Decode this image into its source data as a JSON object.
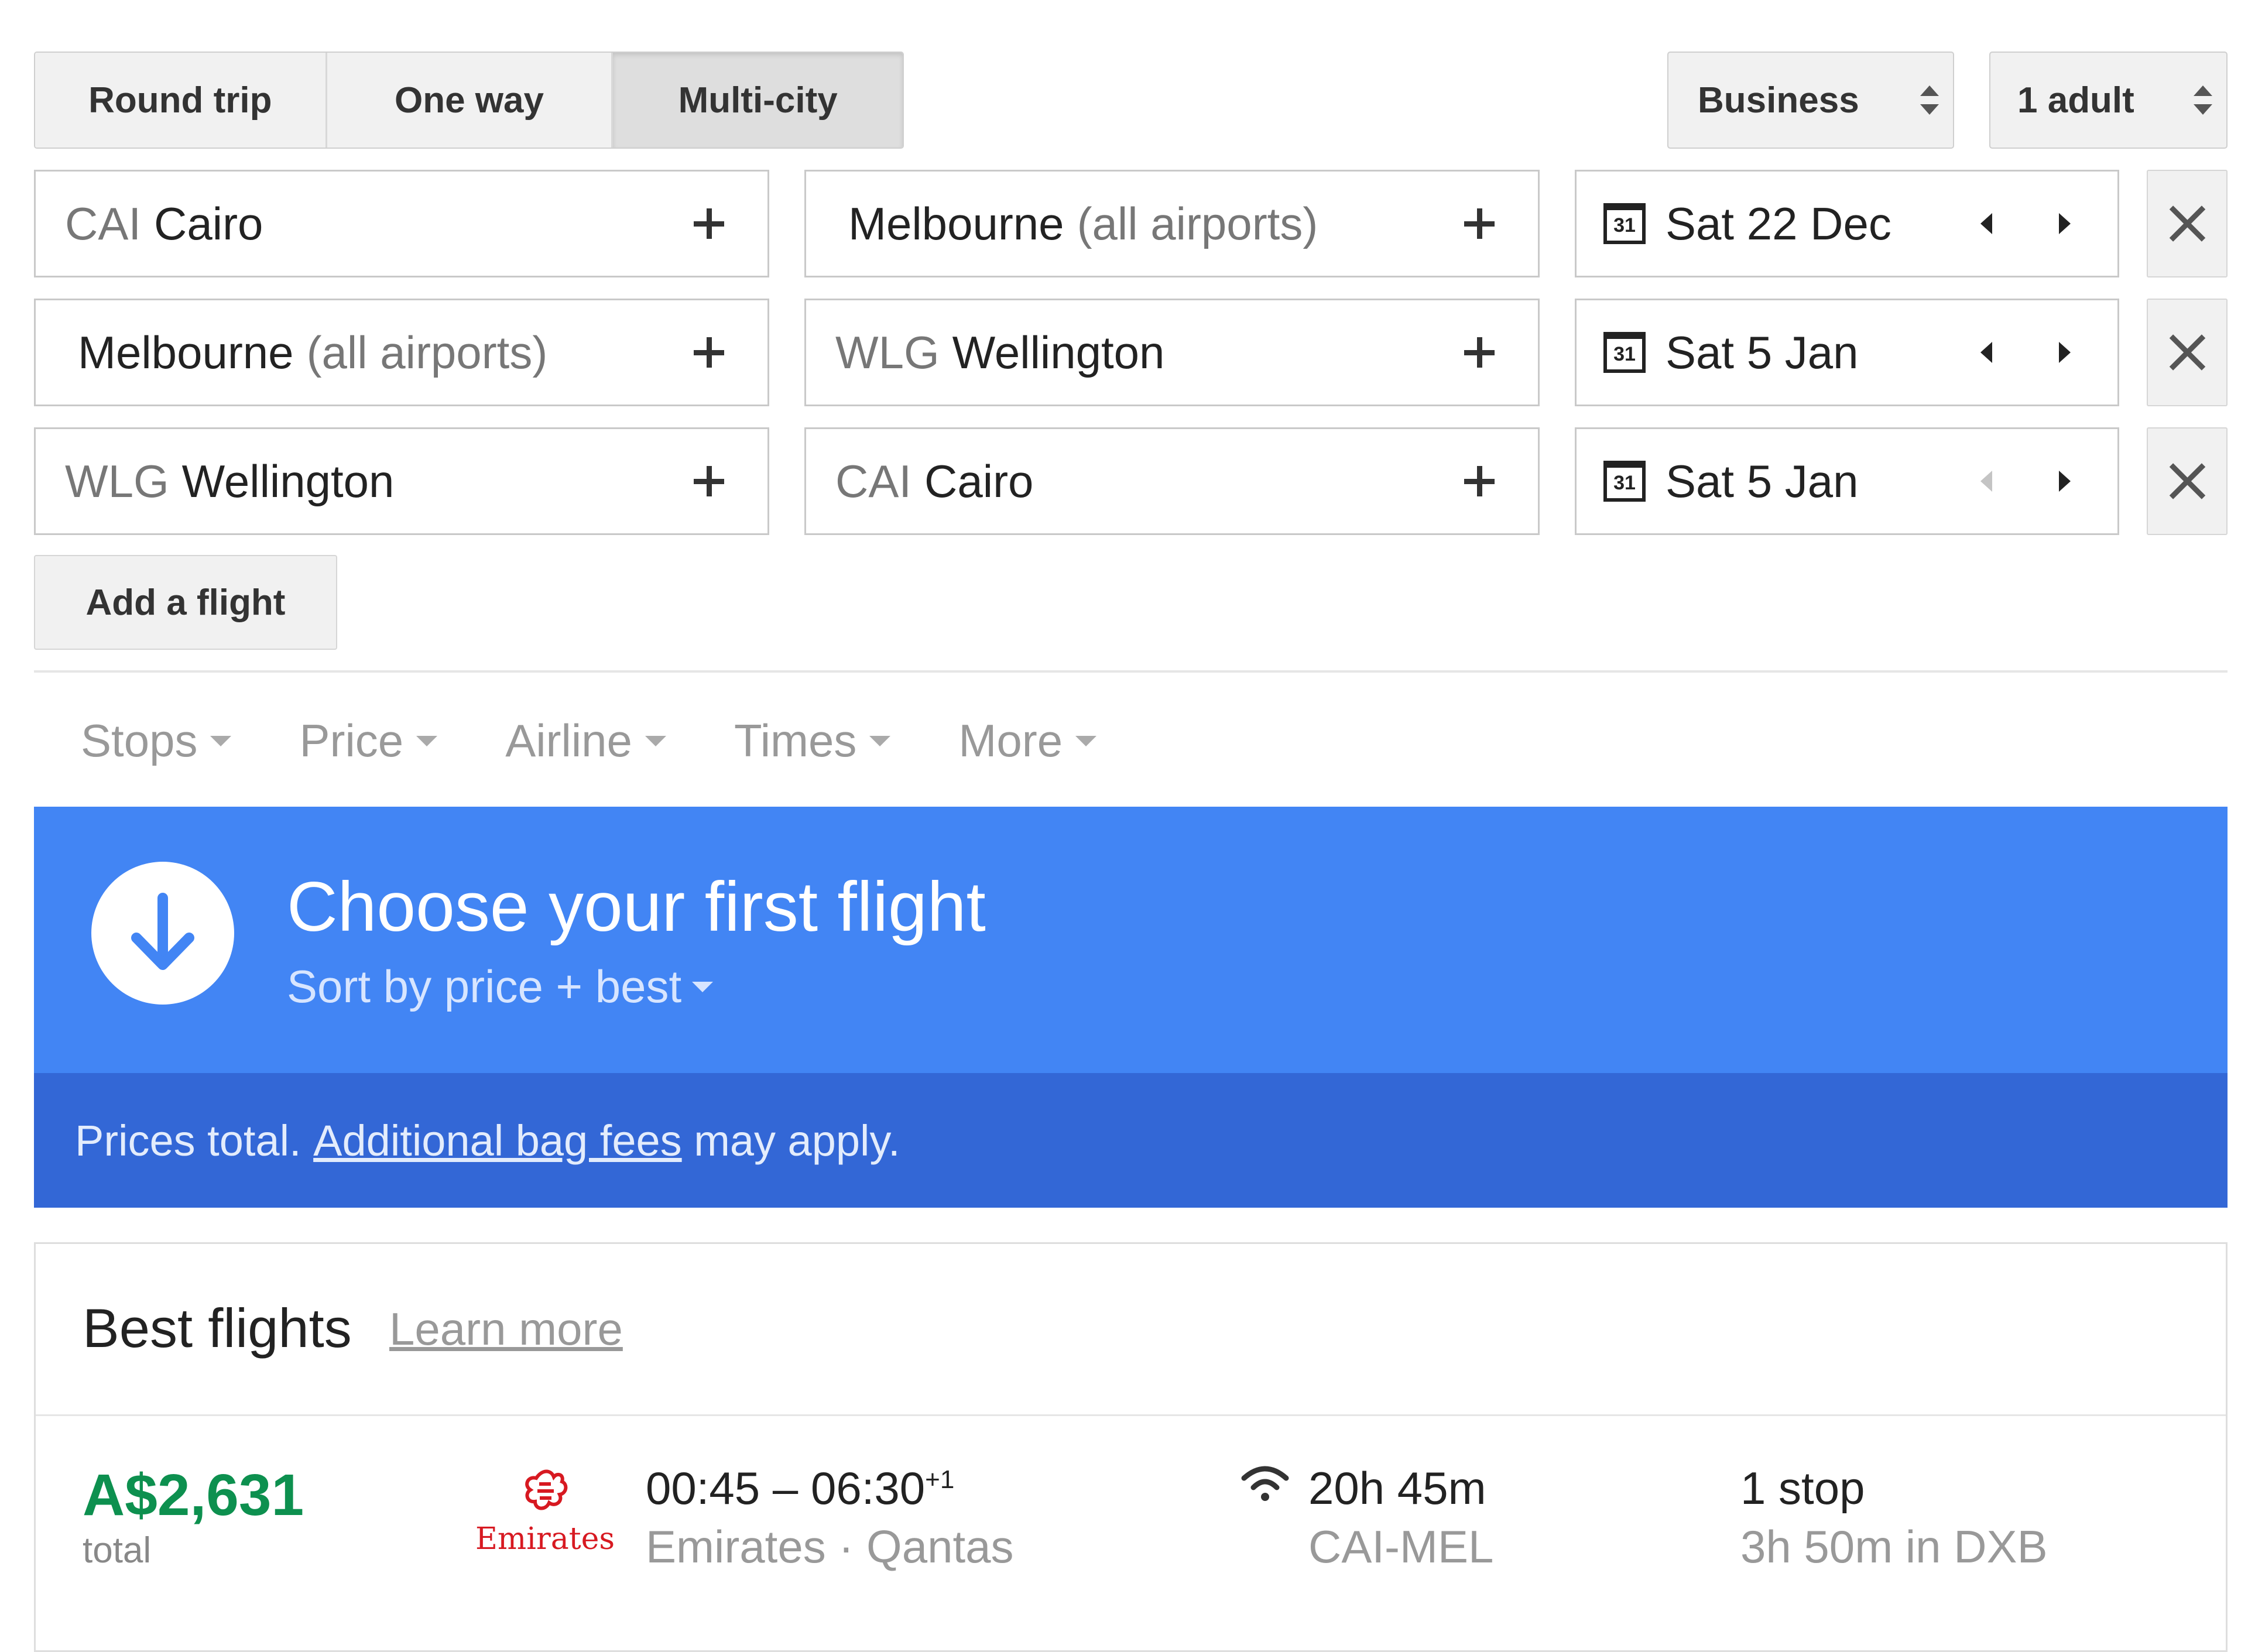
{
  "trip_type": {
    "options": [
      "Round trip",
      "One way",
      "Multi-city"
    ],
    "selected": "Multi-city"
  },
  "cabin_class": {
    "value": "Business"
  },
  "passengers": {
    "value": "1 adult"
  },
  "legs": [
    {
      "origin": {
        "code": "CAI",
        "name": "Cairo",
        "suffix": ""
      },
      "destination": {
        "code": "",
        "name": "Melbourne",
        "suffix": "(all airports)"
      },
      "calendar_day": "31",
      "date": "Sat 22 Dec",
      "prev_enabled": true
    },
    {
      "origin": {
        "code": "",
        "name": "Melbourne",
        "suffix": "(all airports)"
      },
      "destination": {
        "code": "WLG",
        "name": "Wellington",
        "suffix": ""
      },
      "calendar_day": "31",
      "date": "Sat 5 Jan",
      "prev_enabled": true
    },
    {
      "origin": {
        "code": "WLG",
        "name": "Wellington",
        "suffix": ""
      },
      "destination": {
        "code": "CAI",
        "name": "Cairo",
        "suffix": ""
      },
      "calendar_day": "31",
      "date": "Sat 5 Jan",
      "prev_enabled": false
    }
  ],
  "add_flight_label": "Add a flight",
  "filters": [
    "Stops",
    "Price",
    "Airline",
    "Times",
    "More"
  ],
  "banner": {
    "title": "Choose your first flight",
    "sort_label": "Sort by price + best",
    "notice_prefix": "Prices total.",
    "notice_link": "Additional bag fees",
    "notice_suffix": "may apply."
  },
  "results": {
    "heading": "Best flights",
    "learn_more": "Learn more",
    "flights": [
      {
        "price": "A$2,631",
        "price_note": "total",
        "airline_logo_text": "Emirates",
        "departure": "00:45",
        "arrival": "06:30",
        "day_offset": "+1",
        "carriers": "Emirates · Qantas",
        "duration": "20h 45m",
        "route": "CAI-MEL",
        "stops": "1 stop",
        "layover": "3h 50m in DXB"
      }
    ]
  },
  "colors": {
    "banner": "#4285f4",
    "banner_dark": "#3367d6",
    "price": "#0d904f",
    "airline": "#d71921"
  },
  "icons": [
    "plus-icon",
    "calendar-icon",
    "arrow-left-icon",
    "arrow-right-icon",
    "close-icon",
    "caret-down-icon",
    "arrow-down-circle-icon",
    "wifi-icon",
    "emirates-logo"
  ]
}
